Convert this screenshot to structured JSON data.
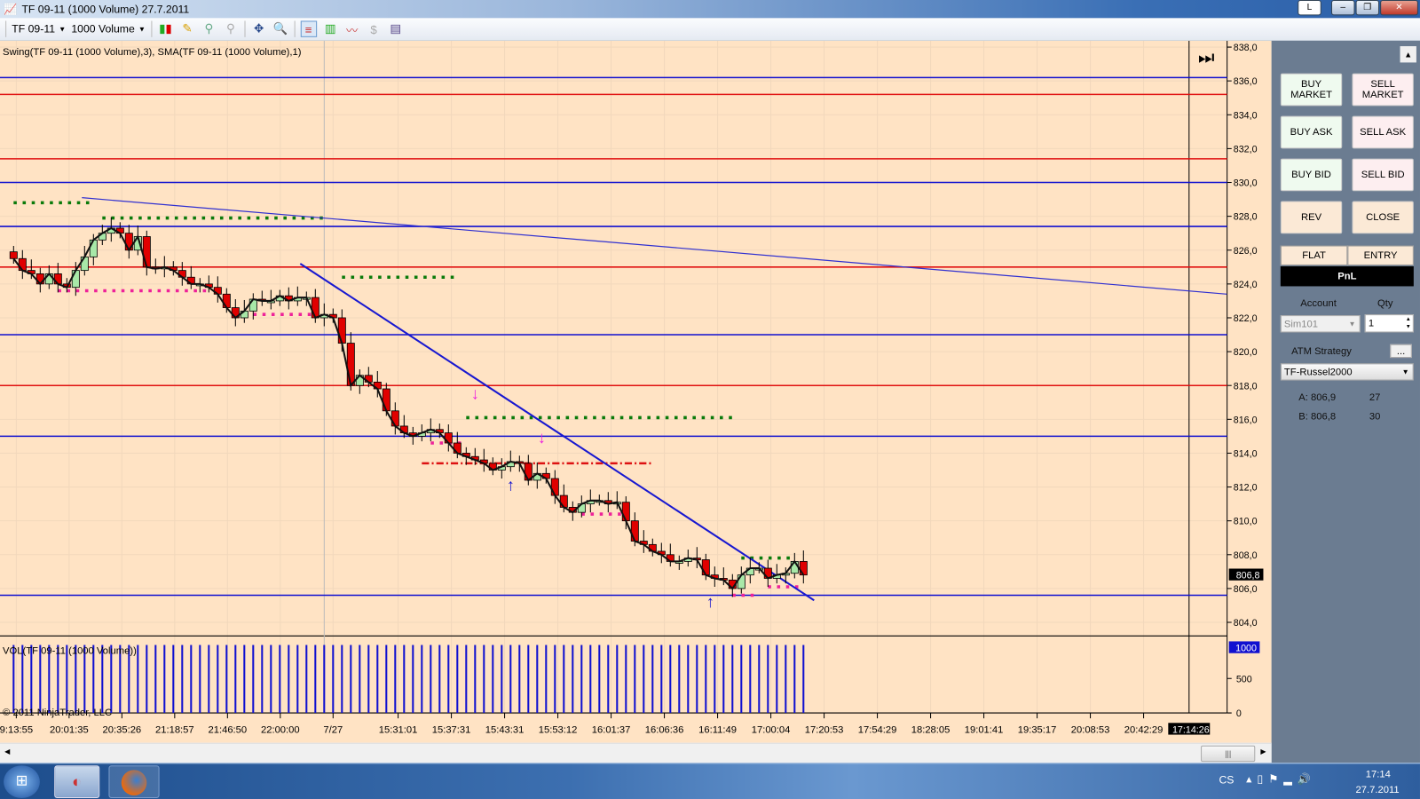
{
  "window": {
    "title": "TF 09-11 (1000 Volume)  27.7.2011",
    "lang_badge": "L",
    "min": "–",
    "max": "❐",
    "close": "✕"
  },
  "toolbar": {
    "instrument": "TF 09-11",
    "period": "1000 Volume"
  },
  "chart": {
    "indicator_label": "Swing(TF 09-11 (1000 Volume),3), SMA(TF 09-11 (1000 Volume),1)",
    "volume_label": "VOL(TF 09-11 (1000 Volume))",
    "copyright": "© 2011 NinjaTrader, LLC",
    "current_price": "806,8",
    "current_volume": "1000",
    "current_time": "17:14:26",
    "price_ticks": [
      "838,0",
      "836,0",
      "834,0",
      "832,0",
      "830,0",
      "828,0",
      "826,0",
      "824,0",
      "822,0",
      "820,0",
      "818,0",
      "816,0",
      "814,0",
      "812,0",
      "810,0",
      "808,0",
      "806,0",
      "804,0"
    ],
    "volume_ticks": [
      "500",
      "0"
    ],
    "time_ticks": [
      "9:13:55",
      "20:01:35",
      "20:35:26",
      "21:18:57",
      "21:46:50",
      "22:00:00",
      "7/27",
      "15:31:01",
      "15:37:31",
      "15:43:31",
      "15:53:12",
      "16:01:37",
      "16:06:36",
      "16:11:49",
      "17:00:04",
      "17:20:53",
      "17:54:29",
      "18:28:05",
      "19:01:41",
      "19:35:17",
      "20:08:53",
      "20:42:29"
    ]
  },
  "chart_data": {
    "type": "candlestick",
    "price_range": [
      804,
      838
    ],
    "volume_range": [
      0,
      1000
    ],
    "closes": [
      825.5,
      824.8,
      824.6,
      824.0,
      824.6,
      824.0,
      823.8,
      824.8,
      825.6,
      826.6,
      827.0,
      827.3,
      827.0,
      826.0,
      826.8,
      825.0,
      824.9,
      825.0,
      824.8,
      824.4,
      824.0,
      824.0,
      823.8,
      823.4,
      822.6,
      822.0,
      822.4,
      823.1,
      823.0,
      823.0,
      823.3,
      823.0,
      823.2,
      823.2,
      822.0,
      822.2,
      822.0,
      820.5,
      818.0,
      818.6,
      818.2,
      817.8,
      816.5,
      815.6,
      815.2,
      815.0,
      815.2,
      815.4,
      815.2,
      814.6,
      814.0,
      813.8,
      813.6,
      813.4,
      813.0,
      813.2,
      813.5,
      813.4,
      812.4,
      812.8,
      812.5,
      811.5,
      810.8,
      810.5,
      811.0,
      811.2,
      811.2,
      811.0,
      811.1,
      810.0,
      808.8,
      808.6,
      808.2,
      808.0,
      807.6,
      807.6,
      807.8,
      807.7,
      806.8,
      806.6,
      806.5,
      806.0,
      806.8,
      807.2,
      807.2,
      806.6,
      806.8,
      806.9,
      807.6,
      806.8
    ],
    "volume_per_bar": 1000,
    "horizontal_lines": [
      {
        "price": 836.2,
        "color": "#1010d0"
      },
      {
        "price": 835.2,
        "color": "#e01010"
      },
      {
        "price": 831.4,
        "color": "#e01010"
      },
      {
        "price": 830.0,
        "color": "#1010d0"
      },
      {
        "price": 827.4,
        "color": "#1010d0"
      },
      {
        "price": 825.0,
        "color": "#e01010"
      },
      {
        "price": 821.0,
        "color": "#1010d0"
      },
      {
        "price": 818.0,
        "color": "#e01010"
      },
      {
        "price": 815.0,
        "color": "#1010d0"
      },
      {
        "price": 805.6,
        "color": "#1010d0"
      }
    ],
    "trend_lines": [
      {
        "from": [
          7.7,
          829.1
        ],
        "to": [
          136.7,
          823.4
        ],
        "color": "#3030d0",
        "thin": true
      },
      {
        "from": [
          32.3,
          825.2
        ],
        "to": [
          90.2,
          805.3
        ],
        "color": "#1818d0",
        "thin": false
      }
    ],
    "swing_levels": [
      {
        "price": 828.8,
        "from": 0,
        "to": 9,
        "color": "#0a7a0a"
      },
      {
        "price": 827.9,
        "from": 10,
        "to": 35,
        "color": "#0a7a0a"
      },
      {
        "price": 823.6,
        "from": 5,
        "to": 22,
        "color": "#ee2299"
      },
      {
        "price": 824.4,
        "from": 37,
        "to": 50,
        "color": "#0a7a0a"
      },
      {
        "price": 822.2,
        "from": 26,
        "to": 34,
        "color": "#ee2299"
      },
      {
        "price": 816.1,
        "from": 51,
        "to": 81,
        "color": "#0a7a0a"
      },
      {
        "price": 814.6,
        "from": 47,
        "to": 51,
        "color": "#ee2299"
      },
      {
        "price": 810.4,
        "from": 64,
        "to": 69,
        "color": "#ee2299"
      },
      {
        "price": 805.6,
        "from": 81,
        "to": 84,
        "color": "#ee2299"
      },
      {
        "price": 807.8,
        "from": 82,
        "to": 88,
        "color": "#0a7a0a"
      },
      {
        "price": 806.1,
        "from": 85,
        "to": 89,
        "color": "#ee2299"
      }
    ],
    "stop_level": {
      "price": 813.4,
      "from": 46,
      "to": 72,
      "color": "#dd1111"
    },
    "colors": {
      "up": "#a8e8a8",
      "down": "#e00000",
      "background": "#ffe3c4"
    }
  },
  "panel": {
    "buttons": [
      {
        "label": "BUY MARKET",
        "kind": "buy"
      },
      {
        "label": "SELL MARKET",
        "kind": "sell"
      },
      {
        "label": "BUY ASK",
        "kind": "buy"
      },
      {
        "label": "SELL ASK",
        "kind": "sell"
      },
      {
        "label": "BUY BID",
        "kind": "buy"
      },
      {
        "label": "SELL BID",
        "kind": "sell"
      },
      {
        "label": "REV",
        "kind": "neu"
      },
      {
        "label": "CLOSE",
        "kind": "neu"
      }
    ],
    "tab_flat": "FLAT",
    "tab_entry": "ENTRY",
    "pnl": "PnL",
    "account_label": "Account",
    "qty_label": "Qty",
    "account": "Sim101",
    "qty": "1",
    "atm_label": "ATM Strategy",
    "atm_btn": "...",
    "atm_value": "TF-Russel2000",
    "ask": "A: 806,9",
    "ask_size": "27",
    "bid": "B: 806,8",
    "bid_size": "30"
  },
  "taskbar": {
    "lang": "CS",
    "time": "17:14",
    "date": "27.7.2011"
  }
}
